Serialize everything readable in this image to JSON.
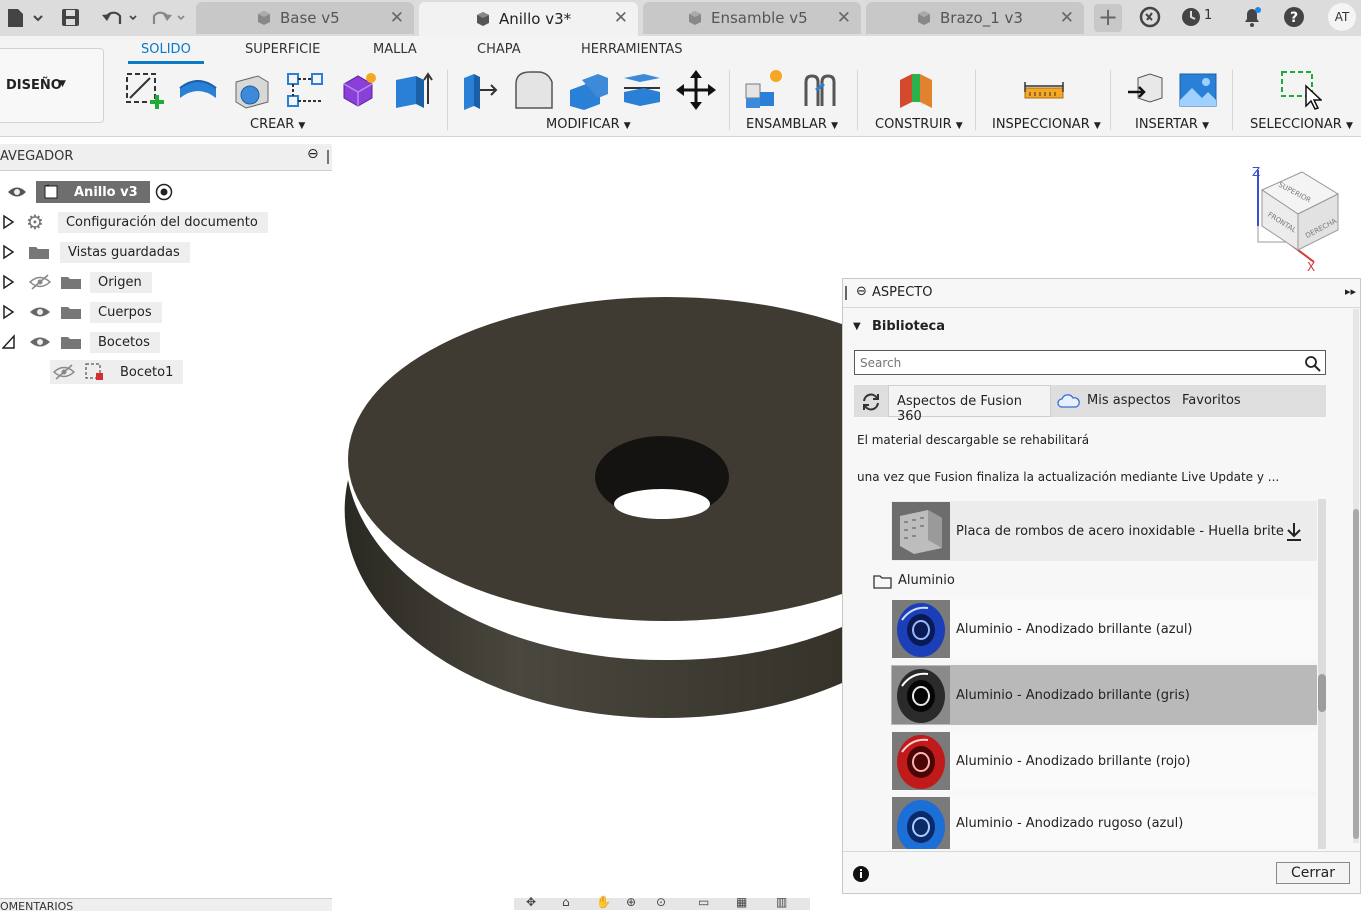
{
  "titlebar": {
    "tabs": [
      {
        "label": "Base v5",
        "active": false
      },
      {
        "label": "Anillo v3*",
        "active": true
      },
      {
        "label": "Ensamble v5",
        "active": false
      },
      {
        "label": "Brazo_1 v3",
        "active": false
      }
    ],
    "jobs_count": "1",
    "user_initials": "AT"
  },
  "toolbar": {
    "workspace": "DISEÑO",
    "ribbon_tabs": [
      "SOLIDO",
      "SUPERFICIE",
      "MALLA",
      "CHAPA",
      "HERRAMIENTAS"
    ],
    "groups": [
      "CREAR",
      "MODIFICAR",
      "ENSAMBLAR",
      "CONSTRUIR",
      "INSPECCIONAR",
      "INSERTAR",
      "SELECCIONAR"
    ]
  },
  "browser": {
    "title": "AVEGADOR",
    "root": "Anillo v3",
    "items": [
      "Configuración del documento",
      "Vistas guardadas",
      "Origen",
      "Cuerpos",
      "Bocetos",
      "Boceto1"
    ]
  },
  "viewcube": {
    "z": "Z",
    "x": "X",
    "top": "SUPERIOR",
    "front": "FRONTAL",
    "right": "DERECHA"
  },
  "panel": {
    "title": "ASPECTO",
    "section": "Biblioteca",
    "search_placeholder": "Search",
    "tabs": [
      "Aspectos de Fusion 360",
      "Mis aspectos",
      "Favoritos"
    ],
    "notice1": "El material descargable se rehabilitará",
    "notice2": "una vez que Fusion finaliza la actualización mediante Live Update y ...",
    "download_item": "Placa de rombos de acero inoxidable - Huella brite",
    "folder": "Aluminio",
    "materials": [
      {
        "label": "Aluminio - Anodizado brillante (azul)",
        "color": "#1a3fb8"
      },
      {
        "label": "Aluminio - Anodizado brillante (gris)",
        "color": "#2a2a2a"
      },
      {
        "label": "Aluminio - Anodizado brillante (rojo)",
        "color": "#c01a1a"
      },
      {
        "label": "Aluminio - Anodizado rugoso (azul)",
        "color": "#1c6fd6"
      }
    ],
    "close_label": "Cerrar"
  },
  "bottom": {
    "comments_label": "OMENTARIOS"
  }
}
